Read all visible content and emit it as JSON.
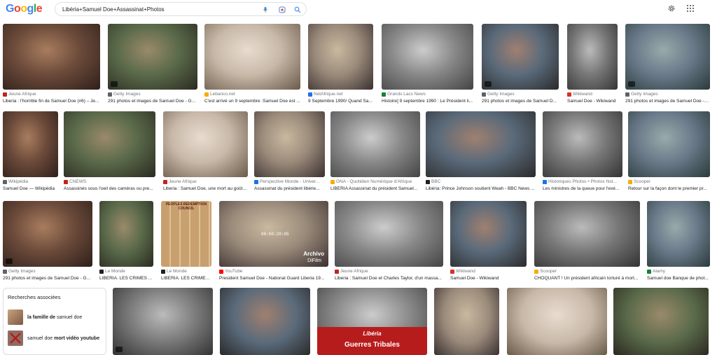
{
  "header": {
    "logo_letters": [
      "G",
      "o",
      "o",
      "g",
      "l",
      "e"
    ],
    "search_value": "Libéria+Samuel Doe+Assassinat+Photos",
    "icons": [
      "mic-icon",
      "lens-icon",
      "search-icon",
      "gear-icon",
      "apps-icon"
    ]
  },
  "results": [
    {
      "source": "Jeune Afrique",
      "title": "Liberia : l'horrible fin de Samuel Doe (#6) – Je...",
      "fav": "#c5221f"
    },
    {
      "source": "Getty Images",
      "title": "291 photos et images de Samuel Doe - G...",
      "fav": "#5f6368"
    },
    {
      "source": "Lebanco.net",
      "title": "C'est arrivé un 9 septembre :Samuel Doe est ...",
      "fav": "#f9ab00"
    },
    {
      "source": "NetAfrique.net",
      "title": "9 Septembre 1990/ Quand Sa...",
      "fav": "#1a73e8"
    },
    {
      "source": "Grands Lacs News",
      "title": "Histoire] 9 septembre 1990 : Le Président li...",
      "fav": "#188038"
    },
    {
      "source": "Getty Images",
      "title": "291 photos et images de Samuel D...",
      "fav": "#5f6368"
    },
    {
      "source": "Wikiwand",
      "title": "Samuel Doe - Wikiwand",
      "fav": "#d93025"
    },
    {
      "source": "Getty Images",
      "title": "291 photos et images de Samuel Doe - G...",
      "fav": "#5f6368"
    },
    {
      "source": "Wikipédia",
      "title": "Samuel Doe — Wikipédia",
      "fav": "#5f6368"
    },
    {
      "source": "CNEWS",
      "title": "Assassinés sous l'oeil des caméras ou pre...",
      "fav": "#c5221f"
    },
    {
      "source": "Jeune Afrique",
      "title": "Liberia : Samuel Doe, une mort au goût...",
      "fav": "#c5221f"
    },
    {
      "source": "Perspective Monde - Univer...",
      "title": "Assassinat du président libérie...",
      "fav": "#1a73e8"
    },
    {
      "source": "GNA - Quotidien Numérique d'Afrique",
      "title": "LIBERIA Assassinat du président Samuel...",
      "fav": "#f9ab00"
    },
    {
      "source": "BBC",
      "title": "Libéria: Prince Johnson soutient Weah - BBC News ...",
      "fav": "#202124"
    },
    {
      "source": "Historiques Photos • Photos hist...",
      "title": "Les ministres de la queue pour l'exé...",
      "fav": "#1a73e8"
    },
    {
      "source": "Scooper",
      "title": "Retour sur la façon dont le premier pr...",
      "fav": "#f9ab00"
    },
    {
      "source": "Getty Images",
      "title": "291 photos et images de Samuel Doe - G...",
      "fav": "#5f6368"
    },
    {
      "source": "Le Monde",
      "title": "LIBERIA. LES CRIMES ...",
      "fav": "#202124"
    },
    {
      "source": "Le Monde",
      "title": "LIBERIA. LES CRIMES ...",
      "fav": "#202124"
    },
    {
      "source": "YouTube",
      "title": "President Samuel Doe - National Guard Liberia 19...",
      "fav": "#ff0000"
    },
    {
      "source": "Jeune Afrique",
      "title": "Liberia : Samuel Doe et Charles Taylor, d'un massa...",
      "fav": "#c5221f"
    },
    {
      "source": "Wikiwand",
      "title": "Samuel Doe - Wikiwand",
      "fav": "#d93025"
    },
    {
      "source": "Scooper",
      "title": "CHOQUANT ! Un président africain torturé à mort...",
      "fav": "#f9ab00"
    },
    {
      "source": "Alamy",
      "title": "Samuel doe Banque de phot...",
      "fav": "#188038"
    }
  ],
  "bottom_row_count": 7,
  "overlays": {
    "archivo_line1": "Archivo",
    "archivo_line2": "DiFilm",
    "timecode": "00:00:20:05",
    "liberia_label": "Libéria",
    "guerres_label": "Guerres Tribales",
    "poster_title": "PEOPLES REDEMPTION COUNCIL"
  },
  "related": {
    "title": "Recherches associées",
    "items": [
      {
        "prefix": "la famille de",
        "rest": " samuel doe",
        "bold_first": true
      },
      {
        "prefix": "samuel doe ",
        "rest": "mort vidéo youtube",
        "bold_first": false
      }
    ]
  },
  "colors": {
    "muted_text": "#70757a",
    "border": "#dadce0",
    "youtube_red": "#ff0000",
    "liberia_red": "#b71c1c"
  }
}
